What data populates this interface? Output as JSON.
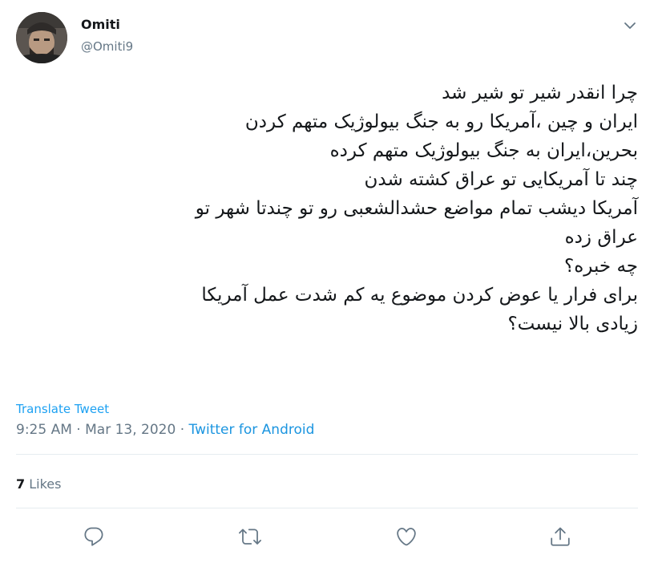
{
  "author": {
    "name": "Omiti",
    "handle": "@Omiti9"
  },
  "tweet": {
    "lines": [
      "چرا انقدر شیر تو شیر شد",
      "ایران و چین ،آمریکا رو به جنگ بیولوژیک متهم کردن",
      "بحرین،ایران به جنگ بیولوژیک متهم کرده",
      "چند تا آمریکایی تو عراق کشته شدن",
      " آمریکا دیشب تمام مواضع حشدالشعبی رو تو چندتا شهر تو",
      "عراق زده",
      "چه خبره؟",
      "برای فرار یا عوض کردن موضوع یه کم شدت عمل آمریکا",
      "زیادی بالا نیست؟"
    ],
    "translate_label": "Translate Tweet",
    "time": "9:25 AM",
    "date": "Mar 13, 2020",
    "separator": "·",
    "source": "Twitter for Android"
  },
  "stats": {
    "likes_count": "7",
    "likes_label": "Likes"
  },
  "icons": {
    "caret": "chevron-down-icon",
    "reply": "reply-icon",
    "retweet": "retweet-icon",
    "like": "heart-icon",
    "share": "share-icon"
  },
  "colors": {
    "link": "#1da1f2",
    "muted": "#657786",
    "text": "#14171a",
    "divider": "#e6ecf0"
  }
}
